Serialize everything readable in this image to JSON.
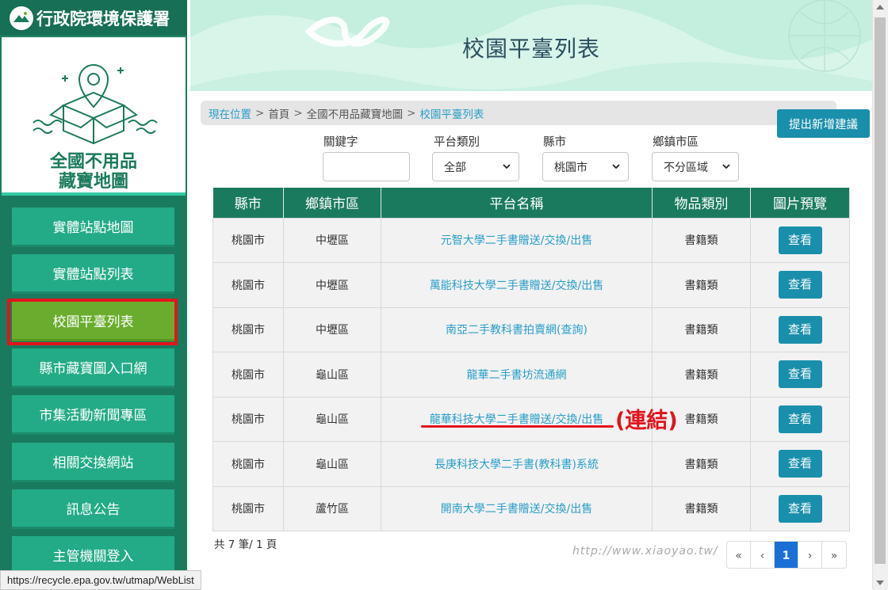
{
  "sidebar": {
    "org_title": "行政院環境保護署",
    "banner_line1": "全國不用品",
    "banner_line2": "藏寶地圖",
    "items": [
      {
        "label": "實體站點地圖"
      },
      {
        "label": "實體站點列表"
      },
      {
        "label": "校園平臺列表",
        "active": true
      },
      {
        "label": "縣市藏寶圖入口網"
      },
      {
        "label": "市集活動新聞專區"
      },
      {
        "label": "相關交換網站"
      },
      {
        "label": "訊息公告"
      },
      {
        "label": "主管機關登入"
      }
    ]
  },
  "hero": {
    "title": "校園平臺列表"
  },
  "breadcrumb": {
    "prefix": "現在位置",
    "home": "首頁",
    "parent": "全國不用品藏寶地圖",
    "current": "校園平臺列表",
    "separator": ">"
  },
  "suggest_button": "提出新增建議",
  "filters": {
    "keyword_label": "關鍵字",
    "keyword_value": "",
    "category_label": "平台類別",
    "category_value": "全部",
    "county_label": "縣市",
    "county_value": "桃園市",
    "district_label": "鄉鎮市區",
    "district_value": "不分區域"
  },
  "table": {
    "headers": [
      "縣市",
      "鄉鎮市區",
      "平台名稱",
      "物品類別",
      "圖片預覽"
    ],
    "view_label": "查看",
    "rows": [
      {
        "county": "桃園市",
        "district": "中壢區",
        "platform": "元智大學二手書贈送/交換/出售",
        "category": "書籍類"
      },
      {
        "county": "桃園市",
        "district": "中壢區",
        "platform": "萬能科技大學二手書贈送/交換/出售",
        "category": "書籍類"
      },
      {
        "county": "桃園市",
        "district": "中壢區",
        "platform": "南亞二手教科書拍賣網(查詢)",
        "category": "書籍類"
      },
      {
        "county": "桃園市",
        "district": "龜山區",
        "platform": "龍華二手書坊流通網",
        "category": "書籍類"
      },
      {
        "county": "桃園市",
        "district": "龜山區",
        "platform": "龍華科技大學二手書贈送/交換/出售",
        "category": "書籍類"
      },
      {
        "county": "桃園市",
        "district": "龜山區",
        "platform": "長庚科技大學二手書(教科書)系統",
        "category": "書籍類"
      },
      {
        "county": "桃園市",
        "district": "蘆竹區",
        "platform": "開南大學二手書贈送/交換/出售",
        "category": "書籍類"
      }
    ]
  },
  "footer": {
    "count_text": "共 7 筆/ 1 頁"
  },
  "pagination": {
    "first": "«",
    "prev": "‹",
    "current": "1",
    "next": "›",
    "last": "»"
  },
  "annotation": {
    "text": "(連結)",
    "color": "#e3131b"
  },
  "watermark": "http://www.xiaoyao.tw/",
  "status_bar": {
    "url": "https://recycle.epa.gov.tw/utmap/WebList"
  },
  "colors": {
    "sidebar": "#1a7a5e",
    "menu_item": "#23ab86",
    "active_item": "#6aad2e",
    "button": "#1a8fab",
    "link": "#2a9ec7",
    "hero_bg": "#d8f5ea"
  }
}
